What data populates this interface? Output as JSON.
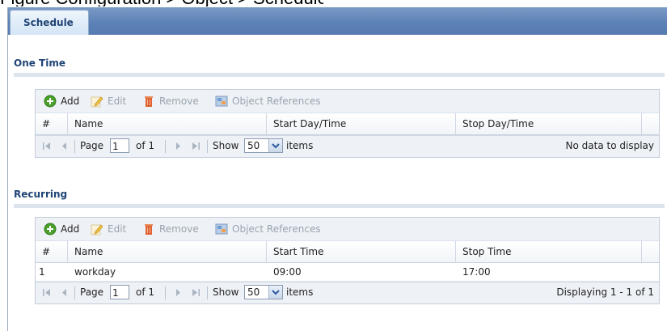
{
  "figure_caption_fragment": "Figure  Configuration > Object > Schedule",
  "tabs": [
    {
      "label": "Schedule"
    }
  ],
  "one_time": {
    "title": "One Time",
    "toolbar": {
      "add": "Add",
      "edit": "Edit",
      "remove": "Remove",
      "object_references": "Object References"
    },
    "columns": [
      "#",
      "Name",
      "Start Day/Time",
      "Stop Day/Time"
    ],
    "rows": [],
    "pager": {
      "page_label": "Page",
      "page_value": "1",
      "of_label": "of 1",
      "show_label": "Show",
      "show_value": "50",
      "items_label": "items",
      "status": "No data to display"
    }
  },
  "recurring": {
    "title": "Recurring",
    "toolbar": {
      "add": "Add",
      "edit": "Edit",
      "remove": "Remove",
      "object_references": "Object References"
    },
    "columns": [
      "#",
      "Name",
      "Start Time",
      "Stop Time"
    ],
    "rows": [
      {
        "num": "1",
        "name": "workday",
        "start": "09:00",
        "stop": "17:00"
      }
    ],
    "pager": {
      "page_label": "Page",
      "page_value": "1",
      "of_label": "of 1",
      "show_label": "Show",
      "show_value": "50",
      "items_label": "items",
      "status": "Displaying 1 - 1 of 1"
    }
  },
  "icons": {
    "add": "add-circle-icon",
    "edit": "edit-pencil-icon",
    "remove": "trash-icon",
    "object_references": "object-references-icon",
    "first": "first-page-icon",
    "prev": "prev-page-icon",
    "next": "next-page-icon",
    "last": "last-page-icon",
    "dropdown": "chevron-down-icon"
  },
  "colors": {
    "tabbar": "#5d82b6",
    "section_title": "#1f4475",
    "add_icon": "#4aa02c",
    "remove_icon": "#e06030"
  }
}
